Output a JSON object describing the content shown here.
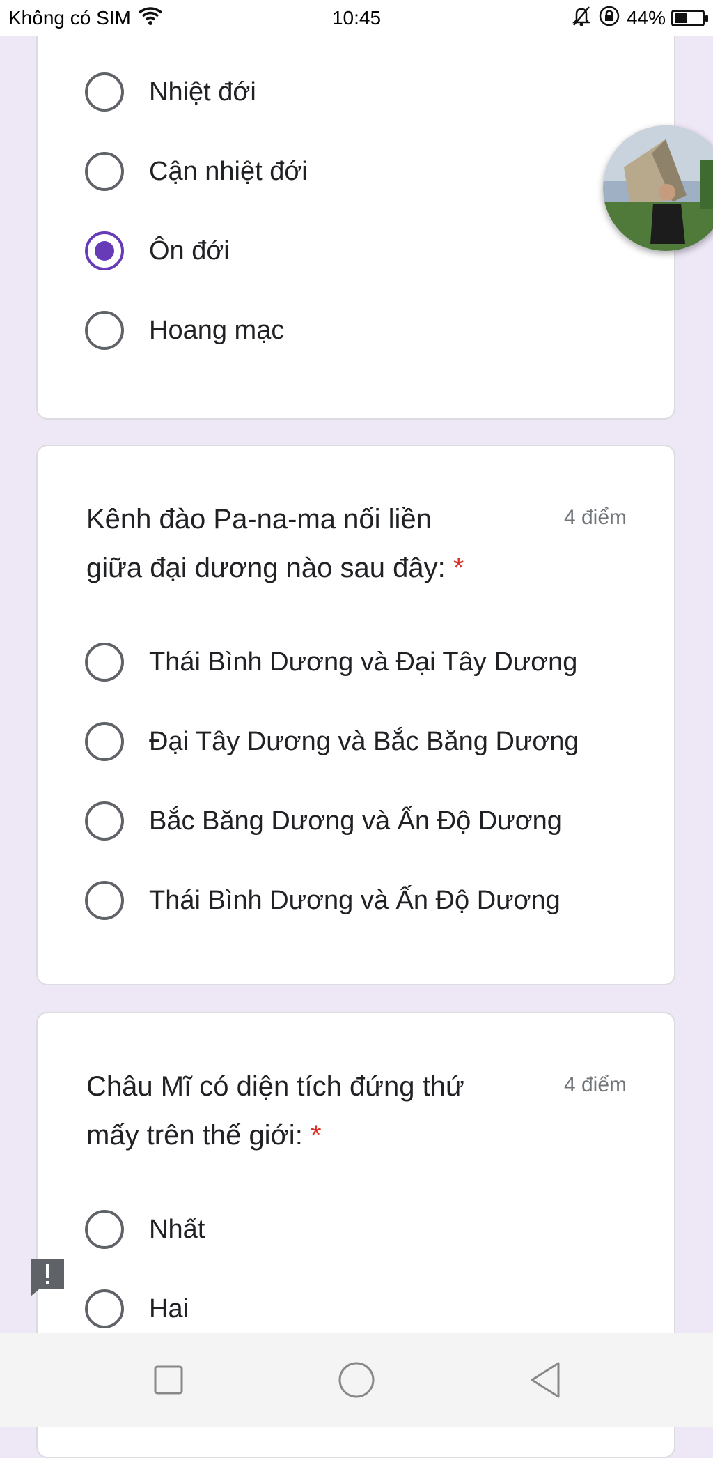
{
  "status_bar": {
    "carrier": "Không có SIM",
    "time": "10:45",
    "battery_percent": "44%",
    "battery_level": 0.44,
    "icons": [
      "wifi-icon",
      "mute-bell-icon",
      "rotation-lock-icon",
      "battery-icon"
    ]
  },
  "card1": {
    "options": [
      {
        "label": "Nhiệt đới",
        "checked": false
      },
      {
        "label": "Cận nhiệt đới",
        "checked": false
      },
      {
        "label": "Ôn đới",
        "checked": true
      },
      {
        "label": "Hoang mạc",
        "checked": false
      }
    ]
  },
  "card2": {
    "question_line1": "Kênh đào Pa-na-ma nối liền",
    "question_line2": "giữa đại dương nào sau đây:",
    "required": "*",
    "points": "4 điểm",
    "options": [
      {
        "label": "Thái Bình Dương và Đại Tây Dương",
        "checked": false
      },
      {
        "label": "Đại Tây Dương và Bắc Băng Dương",
        "checked": false
      },
      {
        "label": "Bắc Băng Dương và Ấn Độ Dương",
        "checked": false
      },
      {
        "label": "Thái Bình Dương và Ấn Độ Dương",
        "checked": false
      }
    ]
  },
  "card3": {
    "question_line1": "Châu Mĩ có diện tích đứng thứ",
    "question_line2": "mấy trên thế giới:",
    "required": "*",
    "points": "4 điểm",
    "options": [
      {
        "label": "Nhất",
        "checked": false
      },
      {
        "label": "Hai",
        "checked": false
      }
    ]
  },
  "colors": {
    "accent": "#673ab7",
    "background": "#ede7f6",
    "required": "#d93025"
  },
  "nav_icons": [
    "recents-square-icon",
    "home-circle-icon",
    "back-triangle-icon"
  ]
}
